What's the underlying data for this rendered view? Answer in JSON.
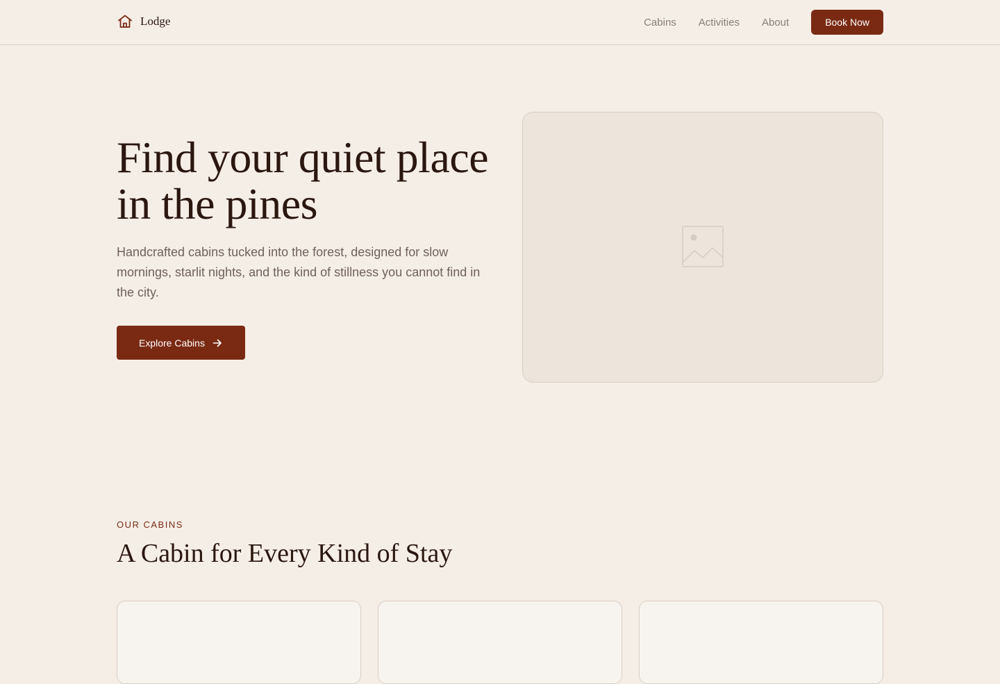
{
  "nav": {
    "brand": "Lodge",
    "brand_icon": "house-icon",
    "links": [
      "Cabins",
      "Activities",
      "About"
    ],
    "cta": "Book Now"
  },
  "hero": {
    "title": "Find your quiet place in the pines",
    "subtitle": "Handcrafted cabins tucked into the forest, designed for slow mornings, starlit nights, and the kind of stillness you cannot find in the city.",
    "button": "Explore Cabins",
    "button_icon": "arrow-right-icon",
    "image_icon": "image-placeholder-icon"
  },
  "cabins": {
    "eyebrow": "OUR CABINS",
    "title": "A Cabin for Every Kind of Stay"
  },
  "colors": {
    "background": "#f5eee6",
    "accent": "#7a2a13",
    "text": "#2a1710",
    "muted": "#6f625b"
  }
}
